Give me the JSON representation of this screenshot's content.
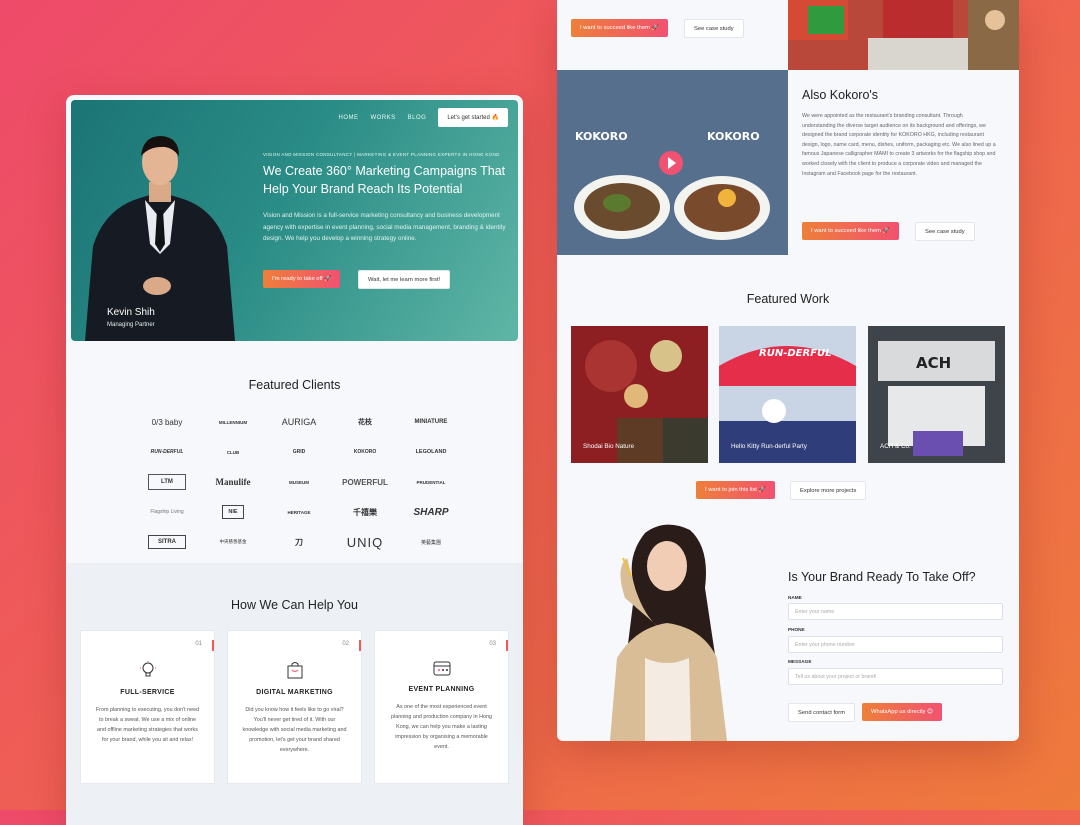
{
  "left": {
    "nav": {
      "items": [
        "HOME",
        "WORKS",
        "BLOG"
      ],
      "cta": "Let's get started 🔥"
    },
    "hero": {
      "eyebrow": "VISION AND MISSION CONSULTANCY | MARKETING & EVENT PLANNING EXPERTS IN HONG KONG",
      "title": "We Create 360° Marketing Campaigns That Help Your Brand Reach Its Potential",
      "body": "Vision and Mission is a full-service marketing consultancy and business development agency with expertise in event planning, social media management, branding & identity design. We help you develop a winning strategy online.",
      "primary_cta": "I'm ready to take off 🚀",
      "secondary_cta": "Wait, let me learn more first!",
      "person_name": "Kevin Shih",
      "person_role": "Managing Partner"
    },
    "clients": {
      "title": "Featured Clients",
      "logos": [
        "0/3 baby",
        "MILLENNIUM",
        "AURIGA",
        "花枝",
        "MINIATURE",
        "RUN-DERFUL",
        "CLUB",
        "GRID",
        "KOKORO",
        "LEGOLAND",
        "LTM",
        "Manulife",
        "MUSEUM",
        "POWERFUL",
        "PRUDENTIAL",
        "Flagship Living",
        "NIE",
        "HERITAGE",
        "千禧樂",
        "SHARP",
        "SITRA",
        "中央慈善基金",
        "刀",
        "UNIQ",
        "英藝集團"
      ]
    },
    "help": {
      "title": "How We Can Help You",
      "cards": [
        {
          "num": "01",
          "title": "FULL-SERVICE",
          "body": "From planning to executing, you don't need to break a sweat. We use a mix of online and offline marketing strategies that works for your brand, while you sit and relax!"
        },
        {
          "num": "02",
          "title": "DIGITAL MARKETING",
          "body": "Did you know how it feels like to go viral? You'll never get tired of it. With our knowledge with social media marketing and promotion, let's get your brand shared everywhere."
        },
        {
          "num": "03",
          "title": "EVENT PLANNING",
          "body": "As one of the most experienced event planning and production company in Hong Kong, we can help you make a lasting impression by organising a memorable event."
        }
      ]
    }
  },
  "right": {
    "top_cta": {
      "primary": "I want to succeed like them 🚀",
      "secondary": "See case study"
    },
    "about": {
      "title": "Also Kokoro's",
      "body": "We were appointed as the restaurant's branding consultant. Through understanding the diverse target audience on its background and offerings, we designed the brand corporate identity for KOKORO HKG, including restaurant design, logo, name card, menu, dishes, uniform, packaging etc. We also lined up a famous Japanese calligrapher MAMI to create 3 artworks for the flagship shop and worked closely with the client to produce a corporate video and managed the Instagram and Facebook page for the restaurant.",
      "primary": "I want to succeed like them 🚀",
      "secondary": "See case study",
      "apron_text": "KOKORO"
    },
    "work": {
      "title": "Featured Work",
      "items": [
        "Shodai Bio Nature",
        "Hello Kitty Run-derful Party",
        "ACH & Co."
      ],
      "banner_text": "RUN-DERFUL",
      "ach_text": "ACH",
      "primary": "I want to join this list 🚀",
      "secondary": "Explore more projects"
    },
    "contact": {
      "title": "Is Your Brand Ready To Take Off?",
      "name_label": "NAME",
      "name_placeholder": "Enter your name",
      "phone_label": "PHONE",
      "phone_placeholder": "Enter your phone number",
      "message_label": "MESSAGE",
      "message_placeholder": "Tell us about your project or brand!",
      "send": "Send contact form",
      "whatsapp": "WhatsApp us directly 😊"
    }
  },
  "colors": {
    "accent_orange": "#ee7f3a",
    "accent_pink": "#f15271",
    "hero_teal": "#1b7475",
    "background": "#f6f8fb"
  }
}
